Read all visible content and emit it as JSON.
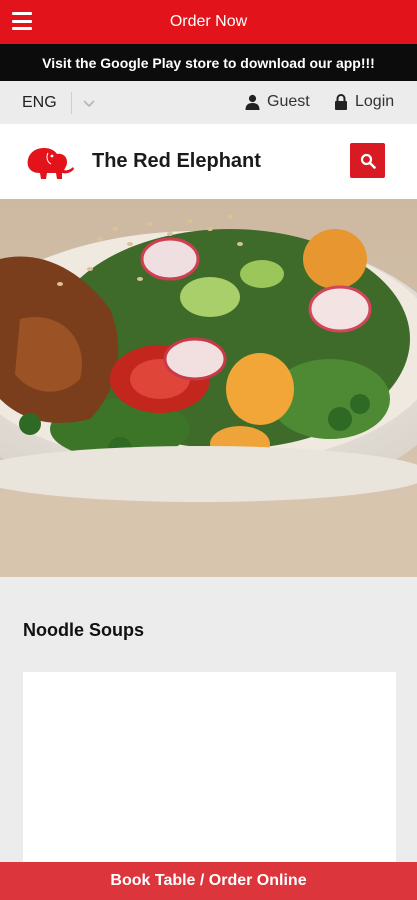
{
  "topbar": {
    "menu_icon": "hamburger-menu-icon",
    "order_label": "Order Now"
  },
  "promo": {
    "text": "Visit the Google Play store to download our app!!!"
  },
  "lang_bar": {
    "language": "ENG",
    "language_icon": "chevron-down-icon",
    "guest_label": "Guest",
    "guest_icon": "user-icon",
    "login_label": "Login",
    "login_icon": "lock-icon"
  },
  "brand": {
    "name": "The Red Elephant",
    "logo_icon": "elephant-logo-icon",
    "search_icon": "search-icon"
  },
  "hero": {
    "image": "salad-dish-photo"
  },
  "section": {
    "title": "Noodle Soups"
  },
  "bottom_bar": {
    "label": "Book Table / Order Online"
  },
  "colors": {
    "accent_red": "#e3131b",
    "promo_bg": "#0c0c0c",
    "bottom_bar": "#dd353c",
    "page_bg": "#ececec"
  }
}
